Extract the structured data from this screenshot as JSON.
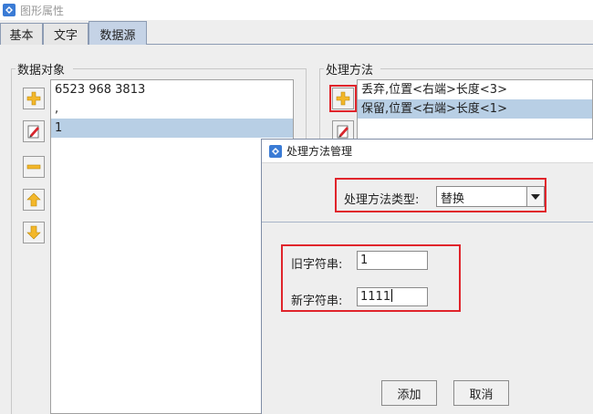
{
  "window": {
    "title": "图形属性"
  },
  "tabs": [
    {
      "label": "基本",
      "active": false
    },
    {
      "label": "文字",
      "active": false
    },
    {
      "label": "数据源",
      "active": true
    }
  ],
  "data_object": {
    "group_label": "数据对象",
    "items": [
      "6523 968 3813",
      ",",
      "1"
    ],
    "selected_index": 2,
    "toolbar": [
      "add-icon",
      "edit-icon",
      "remove-icon",
      "move-up-icon",
      "move-down-icon"
    ]
  },
  "processing": {
    "group_label": "处理方法",
    "items": [
      "丢弃,位置<右端>长度<3>",
      "保留,位置<右端>长度<1>"
    ],
    "selected_index": 1,
    "toolbar": [
      "add-icon",
      "edit-icon"
    ]
  },
  "dialog": {
    "title": "处理方法管理",
    "type_label": "处理方法类型:",
    "type_value": "替换",
    "old_label": "旧字符串:",
    "old_value": "1",
    "new_label": "新字符串:",
    "new_value": "1111",
    "add_button": "添加",
    "cancel_button": "取消"
  },
  "colors": {
    "highlight_red": "#e0242b",
    "selection": "#b8cfe5",
    "active_tab": "#c5d3e6"
  }
}
